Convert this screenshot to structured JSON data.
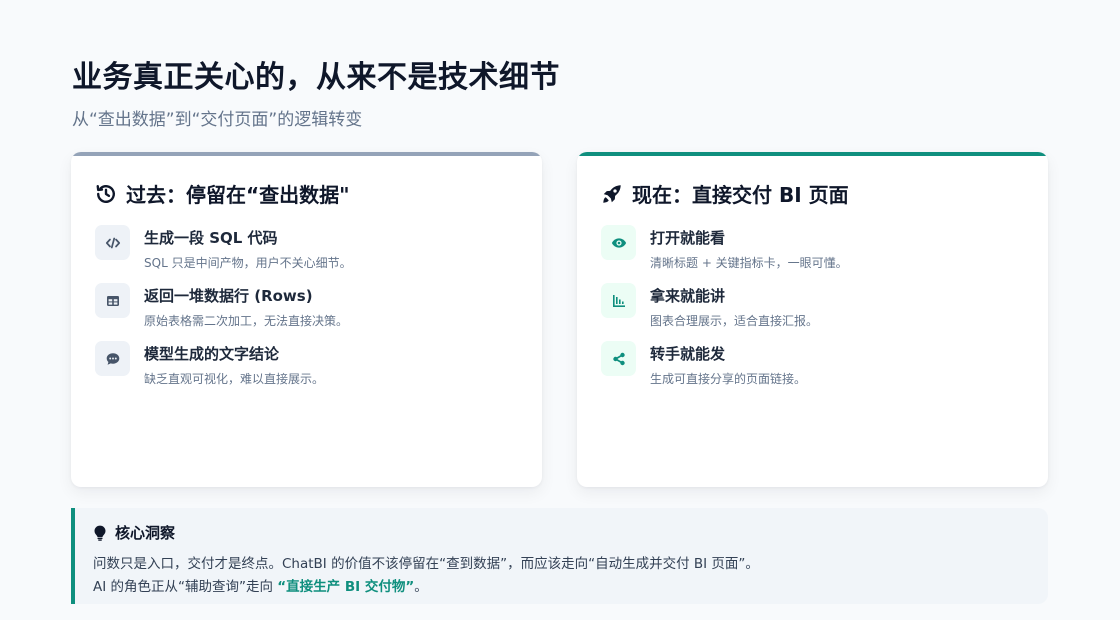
{
  "header": {
    "title": "业务真正关心的，从来不是技术细节",
    "subtitle": "从“查出数据”到“交付页面”的逻辑转变"
  },
  "past": {
    "icon": "history-icon",
    "title": "过去：停留在“查出数据\"",
    "items": [
      {
        "icon": "code-icon",
        "title": "生成一段 SQL 代码",
        "desc": "SQL 只是中间产物，用户不关心细节。"
      },
      {
        "icon": "table-icon",
        "title": "返回一堆数据行 (Rows)",
        "desc": "原始表格需二次加工，无法直接决策。"
      },
      {
        "icon": "comment-icon",
        "title": "模型生成的文字结论",
        "desc": "缺乏直观可视化，难以直接展示。"
      }
    ]
  },
  "now": {
    "icon": "rocket-icon",
    "title": "现在：直接交付 BI 页面",
    "items": [
      {
        "icon": "eye-icon",
        "title": "打开就能看",
        "desc": "清晰标题 + 关键指标卡，一眼可懂。"
      },
      {
        "icon": "bar-chart-icon",
        "title": "拿来就能讲",
        "desc": "图表合理展示，适合直接汇报。"
      },
      {
        "icon": "share-icon",
        "title": "转手就能发",
        "desc": "生成可直接分享的页面链接。"
      }
    ]
  },
  "insight": {
    "icon": "lightbulb-icon",
    "title": "核心洞察",
    "line1": "问数只是入口，交付才是终点。ChatBI 的价值不该停留在“查到数据”，而应该走向“自动生成并交付 BI 页面”。",
    "line2_prefix": "AI 的角色正从“辅助查询”走向 ",
    "line2_highlight": "“直接生产 BI 交付物”",
    "line2_suffix": "。"
  },
  "colors": {
    "accent": "#0f8f7e",
    "past_bar": "#94a3b8",
    "title": "#0f172a",
    "muted": "#64748b"
  }
}
